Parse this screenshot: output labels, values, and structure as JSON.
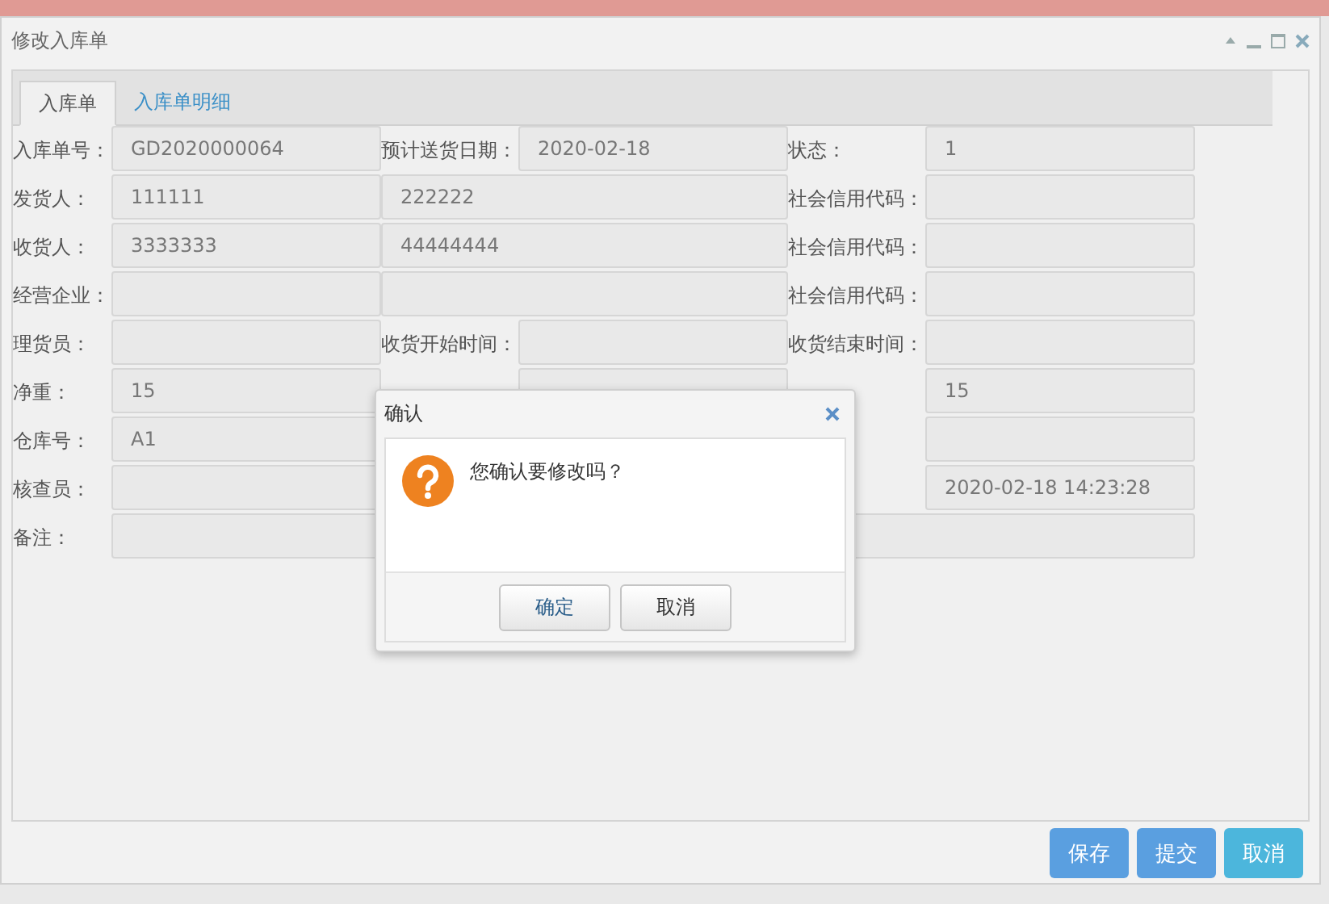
{
  "window": {
    "title": "修改入库单"
  },
  "tabs": [
    {
      "label": "入库单",
      "selected": true
    },
    {
      "label": "入库单明细",
      "selected": false
    }
  ],
  "form": {
    "rows": [
      [
        {
          "kind": "label",
          "text": "入库单号："
        },
        {
          "kind": "field",
          "value": "GD2020000064"
        },
        {
          "kind": "label",
          "text": "预计送货日期："
        },
        {
          "kind": "field",
          "value": "2020-02-18"
        },
        {
          "kind": "label",
          "text": "状态："
        },
        {
          "kind": "field",
          "value": "1"
        }
      ],
      [
        {
          "kind": "label",
          "text": "发货人："
        },
        {
          "kind": "field",
          "value": "111111"
        },
        {
          "kind": "wide_field",
          "value": "222222"
        },
        {
          "kind": "label",
          "text": "社会信用代码："
        },
        {
          "kind": "field"
        }
      ],
      [
        {
          "kind": "label",
          "text": "收货人："
        },
        {
          "kind": "field",
          "value": "3333333"
        },
        {
          "kind": "wide_field",
          "value": "44444444"
        },
        {
          "kind": "label",
          "text": "社会信用代码："
        },
        {
          "kind": "field"
        }
      ],
      [
        {
          "kind": "label",
          "text": "经营企业："
        },
        {
          "kind": "field"
        },
        {
          "kind": "wide_field"
        },
        {
          "kind": "label",
          "text": "社会信用代码："
        },
        {
          "kind": "field"
        }
      ],
      [
        {
          "kind": "label",
          "text": "理货员："
        },
        {
          "kind": "field"
        },
        {
          "kind": "label",
          "text": "收货开始时间："
        },
        {
          "kind": "field"
        },
        {
          "kind": "label",
          "text": "收货结束时间："
        },
        {
          "kind": "field"
        }
      ],
      [
        {
          "kind": "label",
          "text": "净重："
        },
        {
          "kind": "field",
          "value": "15"
        },
        {
          "kind": "blank"
        },
        {
          "kind": "field"
        },
        {
          "kind": "blank"
        },
        {
          "kind": "field",
          "value": "15"
        }
      ],
      [
        {
          "kind": "label",
          "text": "仓库号："
        },
        {
          "kind": "field",
          "value": "A1"
        },
        {
          "kind": "blank"
        },
        {
          "kind": "blank"
        },
        {
          "kind": "blank"
        },
        {
          "kind": "field"
        }
      ],
      [
        {
          "kind": "label",
          "text": "核查员："
        },
        {
          "kind": "field"
        },
        {
          "kind": "blank"
        },
        {
          "kind": "blank"
        },
        {
          "kind": "blank"
        },
        {
          "kind": "field",
          "value": "2020-02-18 14:23:28"
        }
      ],
      [
        {
          "kind": "label",
          "text": "备注："
        },
        {
          "kind": "full_field"
        }
      ]
    ]
  },
  "buttons": [
    {
      "label": "保存",
      "kind": "primary"
    },
    {
      "label": "提交",
      "kind": "primary"
    },
    {
      "label": "取消",
      "kind": "info"
    }
  ],
  "dialog": {
    "title": "确认",
    "message": "您确认要修改吗？",
    "buttons": [
      {
        "label": "确定",
        "kind": "ok"
      },
      {
        "label": "取消",
        "kind": "cancel"
      }
    ]
  }
}
